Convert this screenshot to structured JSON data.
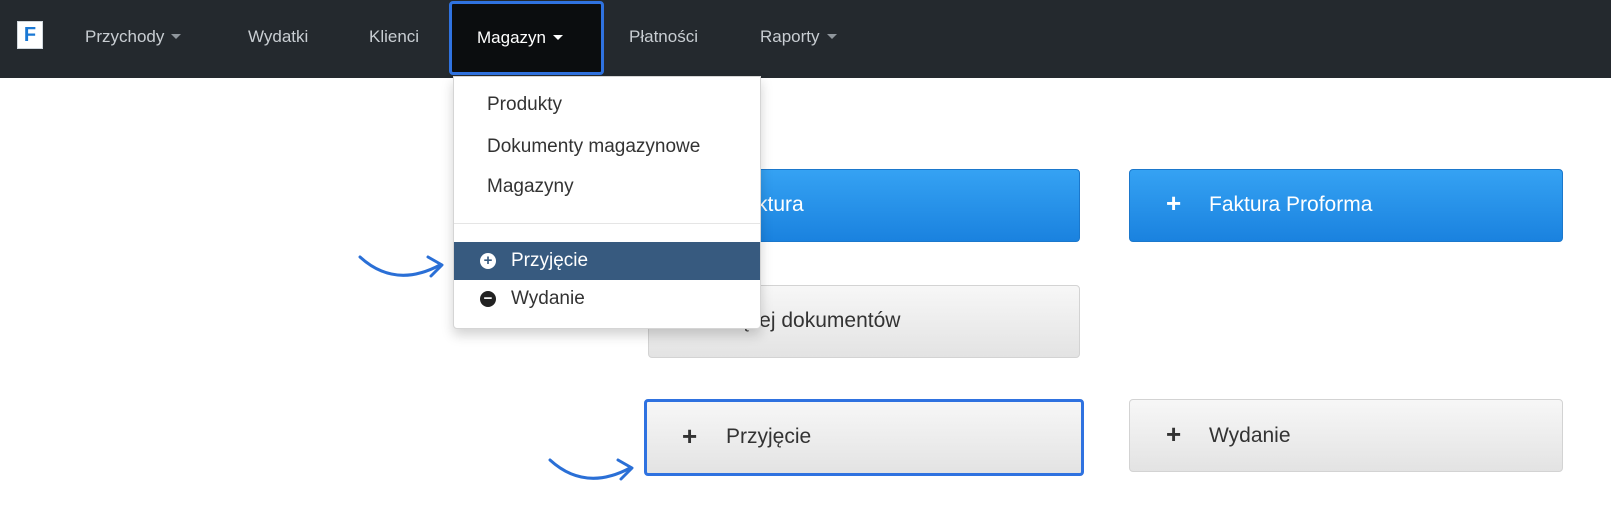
{
  "navbar": {
    "logo_letter": "F",
    "items": [
      {
        "label": "Przychody",
        "has_caret": true
      },
      {
        "label": "Wydatki",
        "has_caret": false
      },
      {
        "label": "Klienci",
        "has_caret": false
      },
      {
        "label": "Magazyn",
        "has_caret": true,
        "active": true
      },
      {
        "label": "Płatności",
        "has_caret": false
      },
      {
        "label": "Raporty",
        "has_caret": true
      }
    ]
  },
  "dropdown": {
    "items": [
      {
        "label": "Produkty"
      },
      {
        "label": "Dokumenty magazynowe"
      },
      {
        "label": "Magazyny"
      }
    ],
    "actions": [
      {
        "label": "Przyjęcie",
        "icon": "plus-circle-icon",
        "highlighted": true
      },
      {
        "label": "Wydanie",
        "icon": "minus-circle-icon",
        "highlighted": false
      }
    ]
  },
  "buttons": {
    "faktura_partial": "ktura",
    "faktura_proforma": "Faktura Proforma",
    "documents_partial": "ącej dokumentów",
    "przyjecie": "Przyjęcie",
    "wydanie": "Wydanie"
  },
  "colors": {
    "navbar_bg": "#24292e",
    "highlight_outline": "#2f72e0",
    "primary_button": "#1a82df",
    "dropdown_active": "#375a7f"
  }
}
